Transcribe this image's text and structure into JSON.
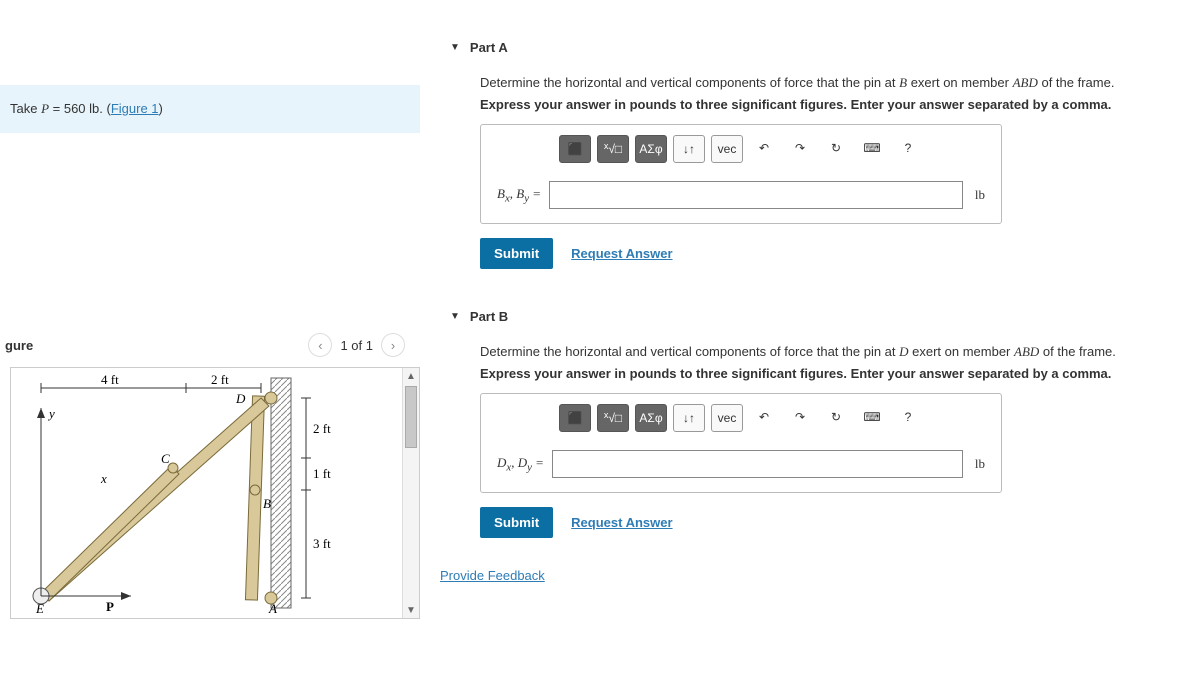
{
  "prompt": {
    "prefix": "Take ",
    "var": "P",
    "equals": " = 560 ",
    "unit": "lb",
    "after": ". (",
    "link": "Figure 1",
    "close": ")"
  },
  "figure": {
    "title": "gure",
    "counter": "1 of 1"
  },
  "diagram": {
    "dim1": "4 ft",
    "dim2": "2 ft",
    "dim3": "2 ft",
    "dim4": "1 ft",
    "dim5": "3 ft",
    "labels": {
      "y": "y",
      "x": "x",
      "E": "E",
      "P": "P",
      "C": "C",
      "B": "B",
      "D": "D",
      "A": "A"
    }
  },
  "parts": [
    {
      "title": "Part A",
      "prompt": {
        "t1": "Determine the horizontal and vertical components of force that the pin at ",
        "pin": "B",
        "t2": " exert on member ",
        "member": "ABD",
        "t3": " of the frame."
      },
      "instruction": "Express your answer in pounds to three significant figures. Enter your answer separated by a comma.",
      "var_label": "Bₓ, Bᵧ =",
      "unit": "lb"
    },
    {
      "title": "Part B",
      "prompt": {
        "t1": "Determine the horizontal and vertical components of force that the pin at ",
        "pin": "D",
        "t2": " exert on member ",
        "member": "ABD",
        "t3": " of the frame."
      },
      "instruction": "Express your answer in pounds to three significant figures. Enter your answer separated by a comma.",
      "var_label": "Dₓ, Dᵧ =",
      "unit": "lb"
    }
  ],
  "toolbar": {
    "templates": "⬛",
    "sqrt": "√□",
    "greek": "ΑΣφ",
    "arrows": "↓↑",
    "vec": "vec",
    "undo": "↶",
    "redo": "↷",
    "reset": "↻",
    "keyboard": "⌨",
    "help": "?"
  },
  "buttons": {
    "submit": "Submit",
    "request": "Request Answer",
    "feedback": "Provide Feedback"
  }
}
